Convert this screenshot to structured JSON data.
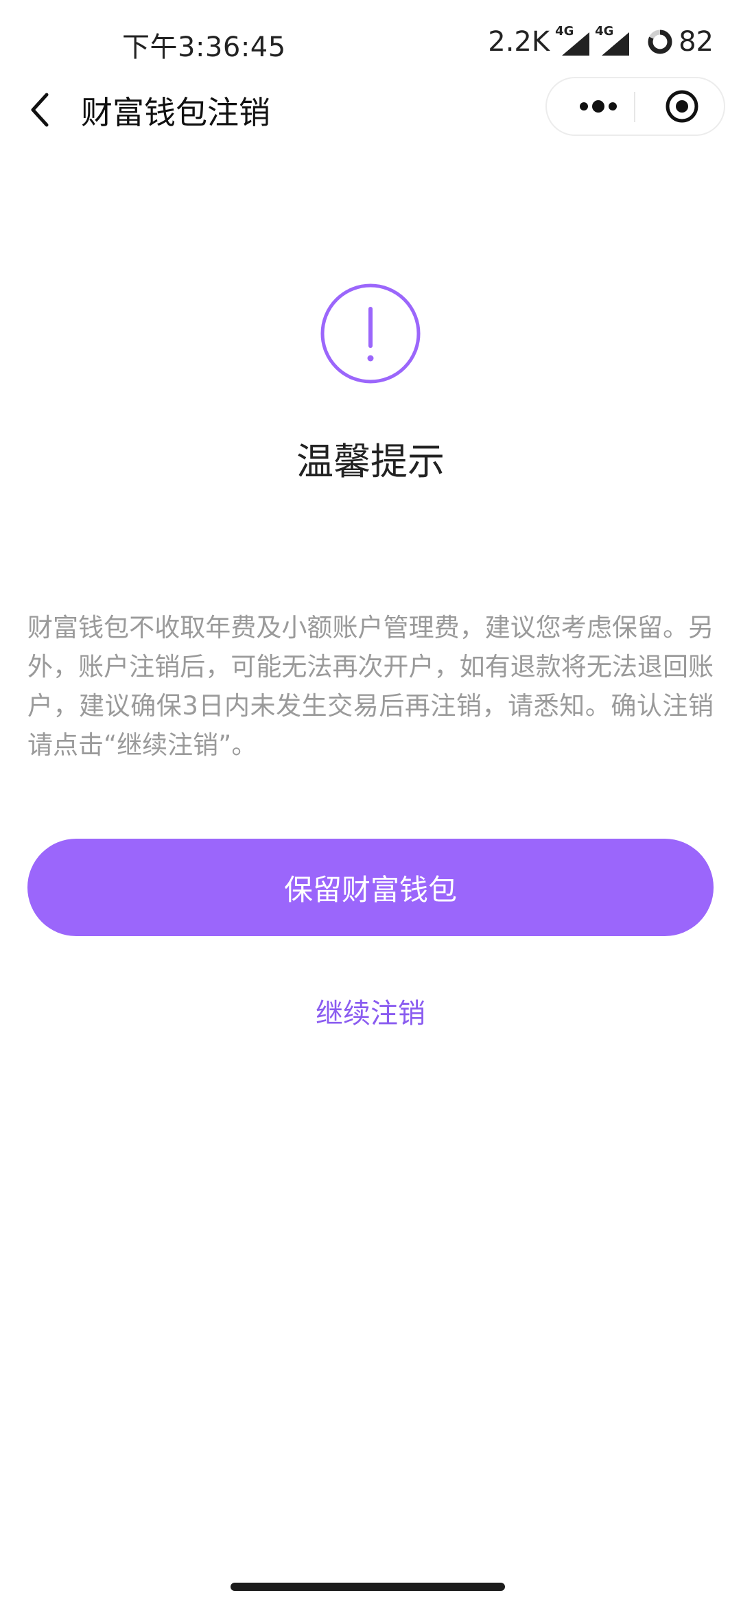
{
  "status_bar": {
    "time": "下午3:36:45",
    "net_speed": "2.2K",
    "sim1_label": "4G",
    "sim2_label": "4G",
    "battery": "82"
  },
  "nav": {
    "title": "财富钱包注销",
    "back_icon": "chevron-left",
    "more_icon": "more-dots",
    "close_icon": "target-circle"
  },
  "main": {
    "icon": "exclamation-circle",
    "icon_color": "#9b66fb",
    "heading": "温馨提示",
    "description": "财富钱包不收取年费及小额账户管理费，建议您考虑保留。另外，账户注销后，可能无法再次开户，如有退款将无法退回账户，建议确保3日内未发生交易后再注销，请悉知。确认注销请点击“继续注销”。",
    "primary_button": "保留财富钱包",
    "secondary_link": "继续注销"
  },
  "colors": {
    "accent": "#9b66fb",
    "link": "#8a5cf0",
    "text_muted": "#9a9a9a"
  }
}
